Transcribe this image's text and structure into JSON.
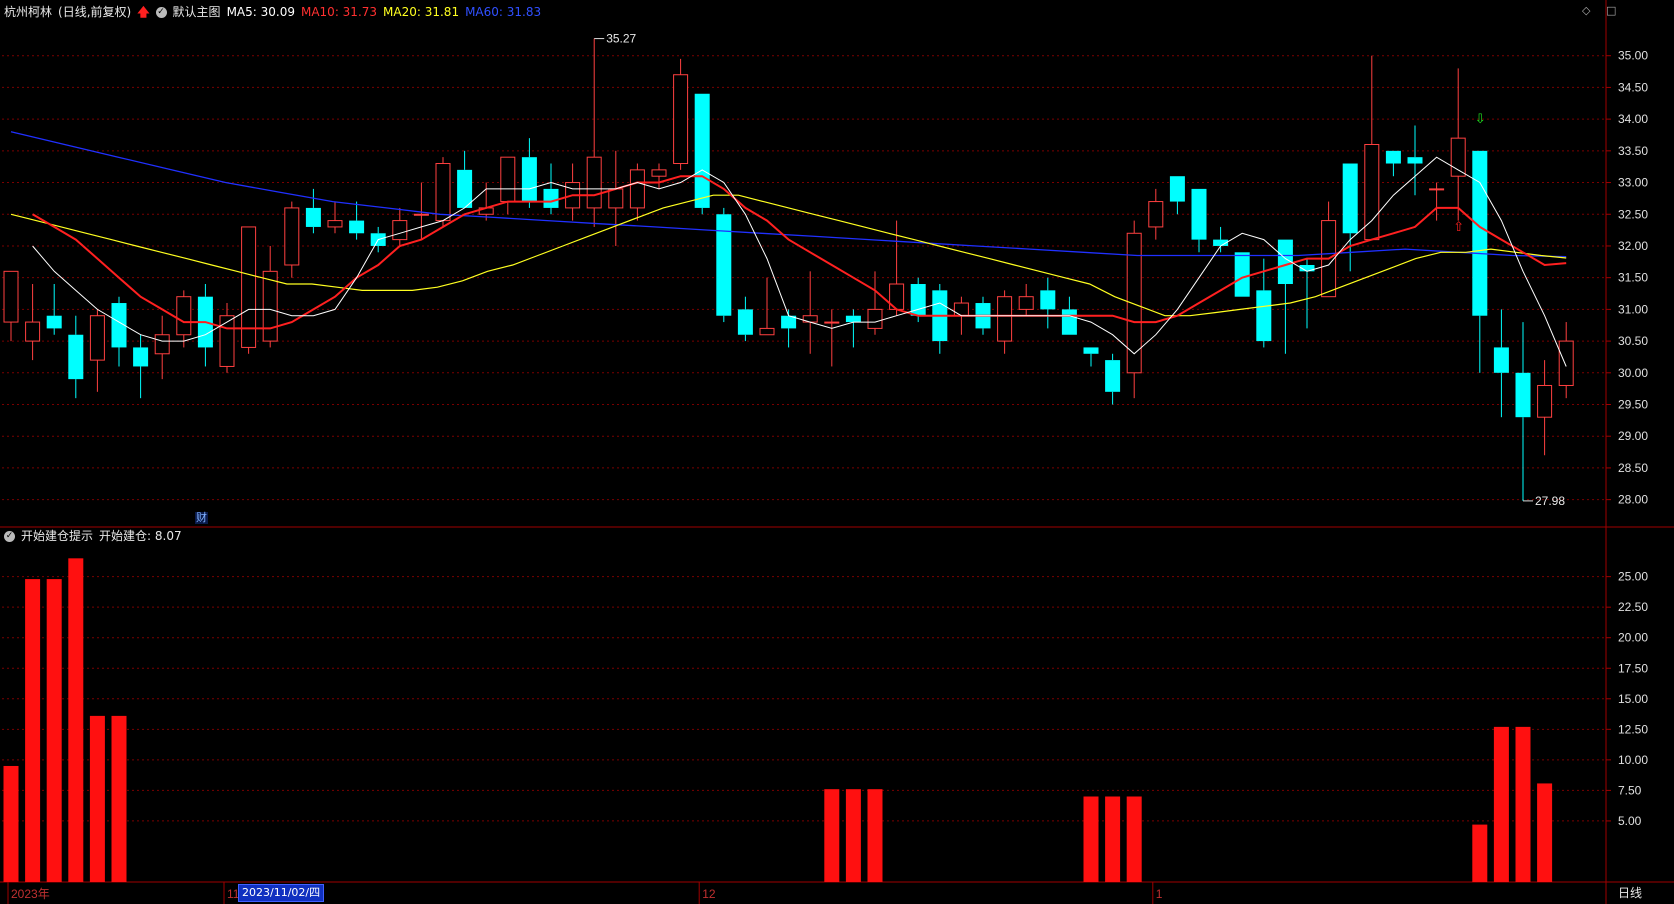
{
  "header": {
    "stock_name": "杭州柯林",
    "mode": "(日线,前复权)",
    "template": "默认主图",
    "ma5": "MA5: 30.09",
    "ma10": "MA10: 31.73",
    "ma20": "MA20: 31.81",
    "ma60": "MA60: 31.83"
  },
  "indicator_header": {
    "name": "开始建仓提示",
    "value": "开始建仓: 8.07"
  },
  "right_icons": "◇ □",
  "period_label": "日线",
  "selected_date": "2023/11/02/四",
  "fin_marker": "财",
  "colors": {
    "background": "#000000",
    "up_candle": "#ff4040",
    "down_candle": "#00ffff",
    "ma5": "#ffffff",
    "ma10": "#ff2020",
    "ma20": "#ffff20",
    "ma60": "#2030ff",
    "grid": "#7a0000",
    "axis_text": "#e0e0e0",
    "bar": "#ff1010"
  },
  "chart_data": [
    {
      "type": "candlestick",
      "title": "杭州柯林 (日线,前复权)",
      "ylim": [
        27.6,
        35.5
      ],
      "yticks": [
        "28.00",
        "28.50",
        "29.00",
        "29.50",
        "30.00",
        "30.50",
        "31.00",
        "31.50",
        "32.00",
        "32.50",
        "33.00",
        "33.50",
        "34.00",
        "34.50",
        "35.00"
      ],
      "x_labels": [
        "2023年",
        "11",
        "12",
        "1"
      ],
      "annotations": [
        {
          "label": "35.27",
          "value": 35.27
        },
        {
          "label": "27.98",
          "value": 27.98
        }
      ],
      "candles": [
        [
          30.8,
          31.6,
          31.6,
          30.5
        ],
        [
          30.5,
          30.8,
          31.4,
          30.2
        ],
        [
          30.9,
          30.7,
          31.4,
          30.6
        ],
        [
          30.6,
          29.9,
          30.9,
          29.6
        ],
        [
          30.2,
          30.9,
          31.0,
          29.7
        ],
        [
          31.1,
          30.4,
          31.2,
          30.1
        ],
        [
          30.4,
          30.1,
          30.6,
          29.6
        ],
        [
          30.3,
          30.6,
          30.9,
          29.9
        ],
        [
          30.6,
          31.2,
          31.3,
          30.4
        ],
        [
          31.2,
          30.4,
          31.4,
          30.1
        ],
        [
          30.1,
          30.9,
          31.1,
          30.0
        ],
        [
          30.4,
          32.3,
          32.3,
          30.3
        ],
        [
          30.5,
          31.6,
          32.0,
          30.4
        ],
        [
          31.7,
          32.6,
          32.7,
          31.5
        ],
        [
          32.6,
          32.3,
          32.9,
          32.2
        ],
        [
          32.3,
          32.4,
          32.7,
          32.2
        ],
        [
          32.4,
          32.2,
          32.7,
          32.1
        ],
        [
          32.2,
          32.0,
          32.3,
          31.9
        ],
        [
          32.1,
          32.4,
          32.6,
          32.0
        ],
        [
          32.5,
          32.5,
          33.0,
          32.1
        ],
        [
          32.4,
          33.3,
          33.4,
          32.3
        ],
        [
          33.2,
          32.6,
          33.5,
          32.6
        ],
        [
          32.5,
          32.6,
          33.0,
          32.4
        ],
        [
          32.7,
          33.4,
          33.4,
          32.5
        ],
        [
          33.4,
          32.7,
          33.7,
          32.6
        ],
        [
          32.9,
          32.6,
          33.3,
          32.5
        ],
        [
          32.6,
          33.0,
          33.3,
          32.4
        ],
        [
          32.6,
          33.4,
          35.27,
          32.3
        ],
        [
          32.6,
          32.9,
          33.5,
          32.0
        ],
        [
          32.6,
          33.2,
          33.3,
          32.4
        ],
        [
          33.1,
          33.2,
          33.3,
          32.9
        ],
        [
          33.3,
          34.7,
          34.95,
          33.2
        ],
        [
          34.4,
          32.6,
          34.4,
          32.5
        ],
        [
          32.5,
          30.9,
          32.6,
          30.8
        ],
        [
          31.0,
          30.6,
          31.2,
          30.5
        ],
        [
          30.6,
          30.7,
          31.5,
          30.6
        ],
        [
          30.9,
          30.7,
          31.0,
          30.4
        ],
        [
          30.8,
          30.9,
          31.6,
          30.3
        ],
        [
          30.8,
          30.8,
          31.0,
          30.1
        ],
        [
          30.9,
          30.8,
          31.0,
          30.4
        ],
        [
          30.7,
          31.0,
          31.6,
          30.6
        ],
        [
          31.0,
          31.4,
          32.4,
          30.9
        ],
        [
          31.4,
          30.9,
          31.5,
          30.8
        ],
        [
          31.3,
          30.5,
          31.4,
          30.3
        ],
        [
          30.9,
          31.1,
          31.2,
          30.6
        ],
        [
          31.1,
          30.7,
          31.2,
          30.6
        ],
        [
          30.5,
          31.2,
          31.3,
          30.3
        ],
        [
          31.0,
          31.2,
          31.4,
          30.9
        ],
        [
          31.3,
          31.0,
          31.5,
          30.7
        ],
        [
          31.0,
          30.6,
          31.2,
          30.6
        ],
        [
          30.4,
          30.3,
          30.4,
          30.1
        ],
        [
          30.2,
          29.7,
          30.3,
          29.5
        ],
        [
          30.0,
          32.2,
          32.4,
          29.6
        ],
        [
          32.3,
          32.7,
          32.9,
          32.1
        ],
        [
          33.1,
          32.7,
          33.1,
          32.5
        ],
        [
          32.9,
          32.1,
          32.9,
          31.9
        ],
        [
          32.1,
          32.0,
          32.3,
          31.9
        ],
        [
          31.9,
          31.2,
          31.9,
          31.2
        ],
        [
          31.3,
          30.5,
          31.8,
          30.4
        ],
        [
          32.1,
          31.4,
          32.1,
          30.3
        ],
        [
          31.7,
          31.6,
          31.8,
          30.7
        ],
        [
          31.2,
          32.4,
          32.7,
          31.2
        ],
        [
          33.3,
          32.2,
          33.3,
          31.6
        ],
        [
          32.1,
          33.6,
          35.0,
          32.1
        ],
        [
          33.5,
          33.3,
          33.5,
          33.1
        ],
        [
          33.4,
          33.3,
          33.9,
          32.8
        ],
        [
          32.9,
          32.9,
          33.0,
          32.4
        ],
        [
          33.1,
          33.7,
          34.8,
          32.4
        ],
        [
          33.5,
          30.9,
          33.5,
          30.0
        ],
        [
          30.4,
          30.0,
          31.0,
          29.3
        ],
        [
          30.0,
          29.3,
          30.8,
          27.98
        ],
        [
          29.3,
          29.8,
          30.2,
          28.7
        ],
        [
          29.8,
          30.5,
          30.8,
          29.6
        ]
      ],
      "ma5": [
        32.0,
        31.6,
        31.3,
        31.0,
        30.8,
        30.6,
        30.5,
        30.5,
        30.6,
        30.8,
        31.0,
        31.0,
        30.9,
        30.9,
        31.0,
        31.5,
        32.1,
        32.2,
        32.3,
        32.4,
        32.6,
        32.9,
        32.9,
        32.9,
        33.0,
        32.9,
        32.9,
        32.9,
        33.0,
        32.9,
        33.0,
        33.2,
        33.0,
        32.5,
        31.8,
        30.9,
        30.8,
        30.7,
        30.8,
        30.8,
        30.9,
        31.0,
        31.1,
        30.9,
        30.9,
        30.9,
        30.9,
        30.9,
        30.9,
        30.8,
        30.6,
        30.3,
        30.6,
        31.0,
        31.5,
        32.0,
        32.2,
        32.1,
        31.8,
        31.6,
        31.7,
        32.1,
        32.4,
        32.8,
        33.1,
        33.4,
        33.2,
        33.0,
        32.4,
        31.6,
        30.9,
        30.1
      ],
      "ma10": [
        32.5,
        32.3,
        32.1,
        31.8,
        31.5,
        31.2,
        31.0,
        30.8,
        30.8,
        30.7,
        30.7,
        30.7,
        30.8,
        31.0,
        31.2,
        31.5,
        31.7,
        32.0,
        32.1,
        32.3,
        32.5,
        32.6,
        32.7,
        32.7,
        32.7,
        32.8,
        32.8,
        32.9,
        33.0,
        33.0,
        33.1,
        33.1,
        32.9,
        32.6,
        32.4,
        32.1,
        31.9,
        31.7,
        31.5,
        31.3,
        31.0,
        30.9,
        30.9,
        30.9,
        30.9,
        30.9,
        30.9,
        30.9,
        30.9,
        30.9,
        30.9,
        30.8,
        30.8,
        30.9,
        31.1,
        31.3,
        31.5,
        31.6,
        31.7,
        31.8,
        31.8,
        32.0,
        32.1,
        32.2,
        32.3,
        32.6,
        32.6,
        32.3,
        32.1,
        31.9,
        31.7,
        31.73
      ],
      "ma20": [
        32.5,
        32.4,
        32.3,
        32.2,
        32.1,
        32.0,
        31.9,
        31.8,
        31.7,
        31.6,
        31.5,
        31.4,
        31.4,
        31.35,
        31.3,
        31.3,
        31.3,
        31.35,
        31.45,
        31.6,
        31.7,
        31.85,
        32.0,
        32.15,
        32.3,
        32.45,
        32.6,
        32.7,
        32.8,
        32.8,
        32.7,
        32.6,
        32.5,
        32.4,
        32.3,
        32.2,
        32.1,
        32.0,
        31.9,
        31.8,
        31.7,
        31.6,
        31.5,
        31.4,
        31.2,
        31.05,
        30.9,
        30.9,
        30.95,
        31.0,
        31.05,
        31.1,
        31.2,
        31.35,
        31.5,
        31.65,
        31.8,
        31.9,
        31.9,
        31.95,
        31.9,
        31.85,
        31.81
      ],
      "ma60": [
        33.8,
        33.6,
        33.4,
        33.2,
        33.0,
        32.85,
        32.7,
        32.6,
        32.5,
        32.45,
        32.4,
        32.35,
        32.3,
        32.25,
        32.2,
        32.15,
        32.1,
        32.05,
        32.0,
        31.95,
        31.9,
        31.85,
        31.85,
        31.85,
        31.85,
        31.9,
        31.95,
        31.9,
        31.85,
        31.83
      ]
    },
    {
      "type": "bar",
      "title": "开始建仓提示",
      "series_name": "开始建仓",
      "ylim": [
        0,
        28
      ],
      "yticks": [
        "5.00",
        "7.50",
        "10.00",
        "12.50",
        "15.00",
        "17.50",
        "20.00",
        "22.50",
        "25.00"
      ],
      "values": [
        9.5,
        24.8,
        24.8,
        26.5,
        13.6,
        13.6,
        0,
        0,
        0,
        0,
        0,
        0,
        0,
        0,
        0,
        0,
        0,
        0,
        0,
        0,
        0,
        0,
        0,
        0,
        0,
        0,
        0,
        0,
        0,
        0,
        0,
        0,
        0,
        0,
        0,
        0,
        0,
        0,
        7.6,
        7.6,
        7.6,
        0,
        0,
        0,
        0,
        0,
        0,
        0,
        0,
        0,
        7.0,
        7.0,
        7.0,
        0,
        0,
        0,
        0,
        0,
        0,
        0,
        0,
        0,
        0,
        0,
        0,
        0,
        0,
        0,
        4.7,
        12.7,
        12.7,
        8.07
      ]
    }
  ]
}
